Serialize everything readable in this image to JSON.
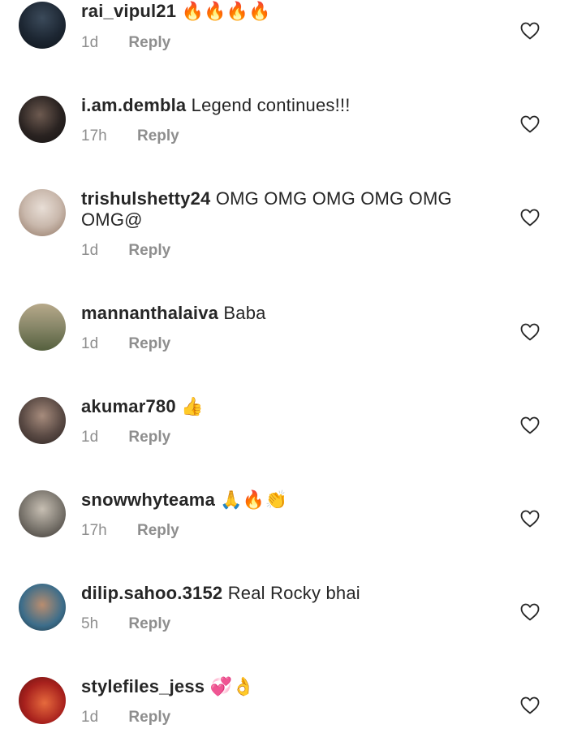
{
  "comments": [
    {
      "username": "rai_vipul21",
      "text": "",
      "emoji": "🔥🔥🔥🔥",
      "time": "1d",
      "reply": "Reply",
      "avatar_colors": [
        "#1d2733",
        "#3b4a5a",
        "#0e141b"
      ]
    },
    {
      "username": "i.am.dembla",
      "text": "Legend continues!!!",
      "emoji": "",
      "time": "17h",
      "reply": "Reply",
      "avatar_colors": [
        "#2a2321",
        "#6d5a50",
        "#121010"
      ]
    },
    {
      "username": "trishulshetty24",
      "text": "OMG OMG OMG OMG OMG",
      "text2": "OMG@",
      "emoji": "",
      "time": "1d",
      "reply": "Reply",
      "avatar_colors": [
        "#c9b8ac",
        "#8f7462",
        "#e8ded6"
      ]
    },
    {
      "username": "mannanthalaiva",
      "text": "Baba",
      "emoji": "",
      "time": "1d",
      "reply": "Reply",
      "avatar_colors": [
        "#8c8a6c",
        "#55603e",
        "#b7a98a"
      ]
    },
    {
      "username": "akumar780",
      "text": "",
      "emoji": "👍",
      "time": "1d",
      "reply": "Reply",
      "avatar_colors": [
        "#5a4a44",
        "#a78c7d",
        "#2b2220"
      ]
    },
    {
      "username": "snowwhyteama",
      "text": "",
      "emoji": "🙏🔥👏",
      "time": "17h",
      "reply": "Reply",
      "avatar_colors": [
        "#7a756d",
        "#c7bfb3",
        "#3b3632"
      ]
    },
    {
      "username": "dilip.sahoo.3152",
      "text": "Real Rocky bhai",
      "emoji": "",
      "time": "5h",
      "reply": "Reply",
      "avatar_colors": [
        "#3c6d8a",
        "#b98d6f",
        "#1d2f3a"
      ]
    },
    {
      "username": "stylefiles_jess",
      "text": "",
      "emoji": "💞👌",
      "time": "1d",
      "reply": "Reply",
      "avatar_colors": [
        "#a8211d",
        "#e66a3d",
        "#5e0f0f"
      ]
    }
  ],
  "icons": {
    "like": "heart-outline-icon"
  }
}
